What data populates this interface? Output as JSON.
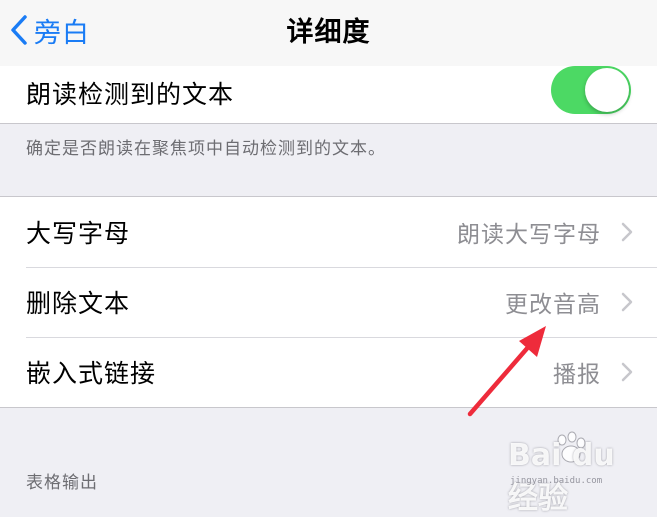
{
  "navbar": {
    "back_label": "旁白",
    "title": "详细度"
  },
  "top_group": {
    "label": "朗读检测到的文本",
    "toggle_on": true,
    "toggle_color": "#4cd964"
  },
  "top_group_note": "确定是否朗读在聚焦项中自动检测到的文本。",
  "settings": {
    "rows": [
      {
        "label": "大写字母",
        "value": "朗读大写字母"
      },
      {
        "label": "删除文本",
        "value": "更改音高"
      },
      {
        "label": "嵌入式链接",
        "value": "播报"
      }
    ]
  },
  "next_section_header": "表格输出",
  "watermark": {
    "text": "Bai du 经验",
    "sub": "jingyan.baidu.com"
  },
  "colors": {
    "accent": "#1a7cf5",
    "annotation_arrow": "#ee2b3b"
  }
}
